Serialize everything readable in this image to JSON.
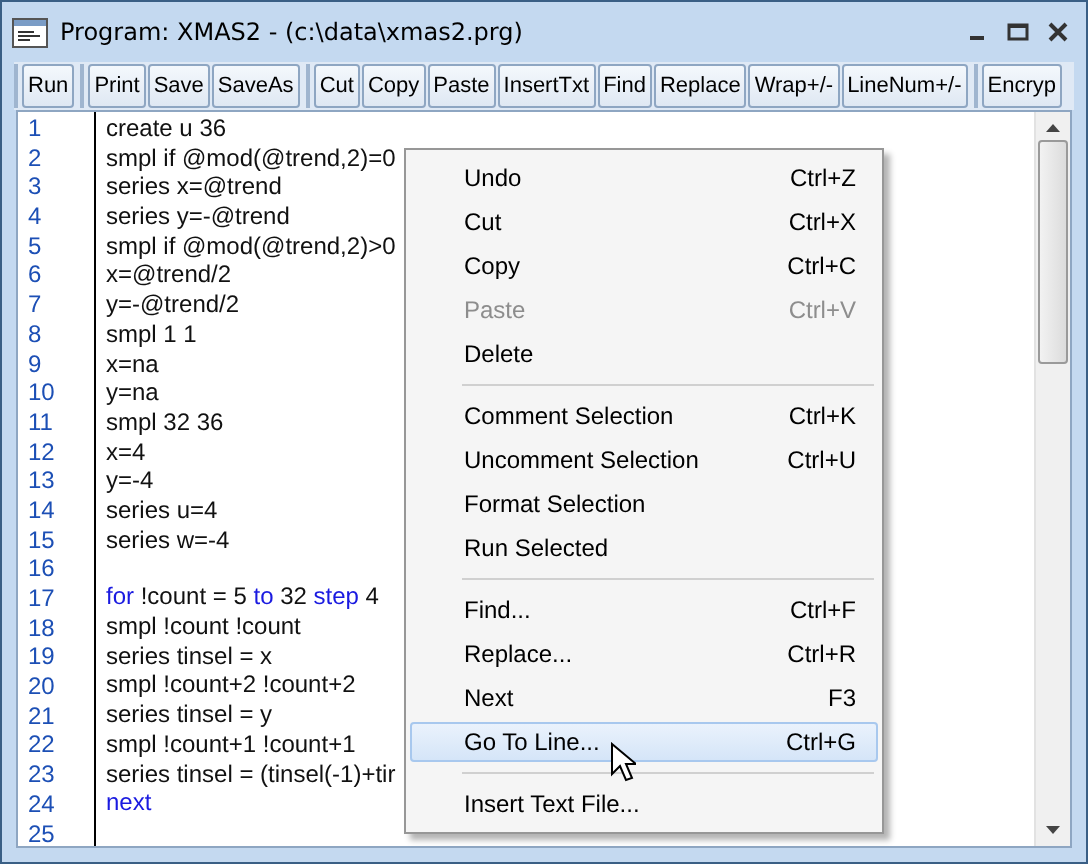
{
  "window": {
    "title": "Program: XMAS2 - (c:\\data\\xmas2.prg)"
  },
  "toolbar": {
    "groups": [
      [
        "Run"
      ],
      [
        "Print",
        "Save",
        "SaveAs"
      ],
      [
        "Cut",
        "Copy",
        "Paste",
        "InsertTxt",
        "Find",
        "Replace",
        "Wrap+/-",
        "LineNum+/-"
      ],
      [
        "Encryp"
      ]
    ]
  },
  "editor": {
    "lines": [
      {
        "number": "1",
        "tokens": [
          {
            "text": "create u 36",
            "keyword": false
          }
        ]
      },
      {
        "number": "2",
        "tokens": [
          {
            "text": "smpl if @mod(@trend,2)=0",
            "keyword": false
          }
        ]
      },
      {
        "number": "3",
        "tokens": [
          {
            "text": "series x=@trend",
            "keyword": false
          }
        ]
      },
      {
        "number": "4",
        "tokens": [
          {
            "text": "series y=-@trend",
            "keyword": false
          }
        ]
      },
      {
        "number": "5",
        "tokens": [
          {
            "text": "smpl if @mod(@trend,2)>0",
            "keyword": false
          }
        ]
      },
      {
        "number": "6",
        "tokens": [
          {
            "text": "x=@trend/2",
            "keyword": false
          }
        ]
      },
      {
        "number": "7",
        "tokens": [
          {
            "text": "y=-@trend/2",
            "keyword": false
          }
        ]
      },
      {
        "number": "8",
        "tokens": [
          {
            "text": "smpl 1 1",
            "keyword": false
          }
        ]
      },
      {
        "number": "9",
        "tokens": [
          {
            "text": "x=na",
            "keyword": false
          }
        ]
      },
      {
        "number": "10",
        "tokens": [
          {
            "text": "y=na",
            "keyword": false
          }
        ]
      },
      {
        "number": "11",
        "tokens": [
          {
            "text": "smpl 32 36",
            "keyword": false
          }
        ]
      },
      {
        "number": "12",
        "tokens": [
          {
            "text": "x=4",
            "keyword": false
          }
        ]
      },
      {
        "number": "13",
        "tokens": [
          {
            "text": "y=-4",
            "keyword": false
          }
        ]
      },
      {
        "number": "14",
        "tokens": [
          {
            "text": "series u=4",
            "keyword": false
          }
        ]
      },
      {
        "number": "15",
        "tokens": [
          {
            "text": "series w=-4",
            "keyword": false
          }
        ]
      },
      {
        "number": "16"
      },
      {
        "number": "17",
        "tokens": [
          {
            "text": "for",
            "keyword": true
          },
          {
            "text": " !count = 5 ",
            "keyword": false
          },
          {
            "text": "to",
            "keyword": true
          },
          {
            "text": " 32 ",
            "keyword": false
          },
          {
            "text": "step",
            "keyword": true
          },
          {
            "text": " 4",
            "keyword": false
          }
        ]
      },
      {
        "number": "18",
        "tokens": [
          {
            "text": "smpl !count !count",
            "keyword": false
          }
        ]
      },
      {
        "number": "19",
        "tokens": [
          {
            "text": "series tinsel = x",
            "keyword": false
          }
        ]
      },
      {
        "number": "20",
        "tokens": [
          {
            "text": "smpl !count+2 !count+2",
            "keyword": false
          }
        ]
      },
      {
        "number": "21",
        "tokens": [
          {
            "text": "series tinsel = y",
            "keyword": false
          }
        ]
      },
      {
        "number": "22",
        "tokens": [
          {
            "text": "smpl !count+1 !count+1",
            "keyword": false
          }
        ]
      },
      {
        "number": "23",
        "tokens": [
          {
            "text": "series tinsel = (tinsel(-1)+tir",
            "keyword": false
          }
        ]
      },
      {
        "number": "24",
        "tokens": [
          {
            "text": "next",
            "keyword": true
          }
        ]
      },
      {
        "number": "25"
      }
    ]
  },
  "context_menu": {
    "items": [
      {
        "kind": "item",
        "label": "Undo",
        "shortcut": "Ctrl+Z",
        "disabled": false,
        "selected": false
      },
      {
        "kind": "item",
        "label": "Cut",
        "shortcut": "Ctrl+X",
        "disabled": false,
        "selected": false
      },
      {
        "kind": "item",
        "label": "Copy",
        "shortcut": "Ctrl+C",
        "disabled": false,
        "selected": false
      },
      {
        "kind": "item",
        "label": "Paste",
        "shortcut": "Ctrl+V",
        "disabled": true,
        "selected": false
      },
      {
        "kind": "item",
        "label": "Delete",
        "disabled": false,
        "selected": false
      },
      {
        "kind": "separator"
      },
      {
        "kind": "item",
        "label": "Comment Selection",
        "shortcut": "Ctrl+K",
        "disabled": false,
        "selected": false
      },
      {
        "kind": "item",
        "label": "Uncomment Selection",
        "shortcut": "Ctrl+U",
        "disabled": false,
        "selected": false
      },
      {
        "kind": "item",
        "label": "Format Selection",
        "disabled": false,
        "selected": false
      },
      {
        "kind": "item",
        "label": "Run Selected",
        "disabled": false,
        "selected": false
      },
      {
        "kind": "separator"
      },
      {
        "kind": "item",
        "label": "Find...",
        "shortcut": "Ctrl+F",
        "disabled": false,
        "selected": false
      },
      {
        "kind": "item",
        "label": "Replace...",
        "shortcut": "Ctrl+R",
        "disabled": false,
        "selected": false
      },
      {
        "kind": "item",
        "label": "Next",
        "shortcut": "F3",
        "disabled": false,
        "selected": false
      },
      {
        "kind": "item",
        "label": "Go To Line...",
        "shortcut": "Ctrl+G",
        "disabled": false,
        "selected": true
      },
      {
        "kind": "separator"
      },
      {
        "kind": "item",
        "label": "Insert Text File...",
        "disabled": false,
        "selected": false
      }
    ]
  }
}
